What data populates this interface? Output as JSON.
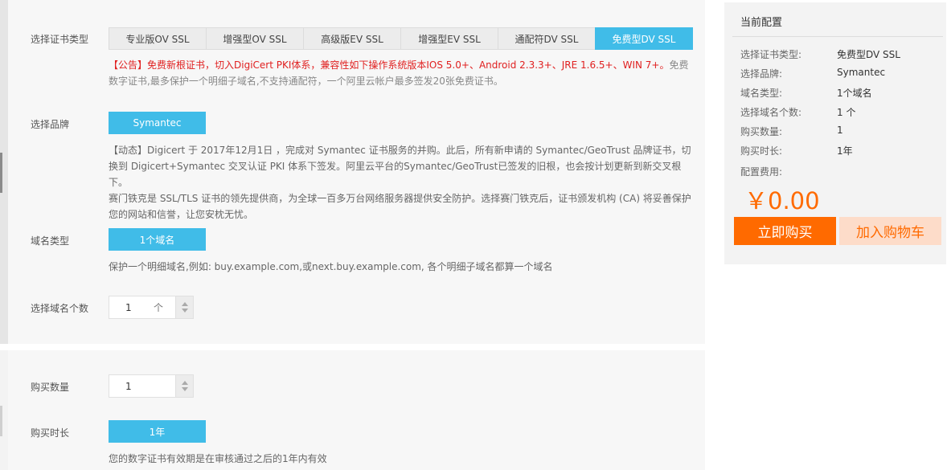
{
  "cert_type": {
    "label": "选择证书类型",
    "tabs": [
      "专业版OV SSL",
      "增强型OV SSL",
      "高级版EV SSL",
      "增强型EV SSL",
      "通配符DV SSL",
      "免费型DV SSL"
    ],
    "active_index": 5,
    "notice_red": "【公告】免费新根证书，切入DigiCert PKI体系，兼容性如下操作系统版本IOS 5.0+、Android 2.3.3+、JRE 1.6.5+、WIN 7+。",
    "notice_gray": "免费数字证书,最多保护一个明细子域名,不支持通配符，一个阿里云帐户最多签发20张免费证书。"
  },
  "brand": {
    "label": "选择品牌",
    "button": "Symantec",
    "desc": "【动态】Digicert 于 2017年12月1日 ，完成对 Symantec 证书服务的并购。此后，所有新申请的 Symantec/GeoTrust 品牌证书，切换到 Digicert+Symantec 交叉认证 PKI 体系下签发。阿里云平台的Symantec/GeoTrust已签发的旧根，也会按计划更新到新交叉根下。\n赛门铁克是 SSL/TLS 证书的领先提供商，为全球一百多万台网络服务器提供安全防护。选择赛门铁克后，证书颁发机构 (CA) 将妥善保护您的网站和信誉，让您安枕无忧。"
  },
  "domain_type": {
    "label": "域名类型",
    "button": "1个域名",
    "desc": "保护一个明细域名,例如: buy.example.com,或next.buy.example.com, 各个明细子域名都算一个域名"
  },
  "domain_count": {
    "label": "选择域名个数",
    "value": "1",
    "unit": "个"
  },
  "quantity": {
    "label": "购买数量",
    "value": "1"
  },
  "duration": {
    "label": "购买时长",
    "button": "1年",
    "desc": "您的数字证书有效期是在审核通过之后的1年内有效"
  },
  "config": {
    "title": "当前配置",
    "rows": [
      {
        "label": "选择证书类型:",
        "value": "免费型DV SSL"
      },
      {
        "label": "选择品牌:",
        "value": "Symantec"
      },
      {
        "label": "域名类型:",
        "value": "1个域名"
      },
      {
        "label": "选择域名个数:",
        "value": "1 个"
      },
      {
        "label": "购买数量:",
        "value": "1"
      },
      {
        "label": "购买时长:",
        "value": "1年"
      }
    ],
    "fee_label": "配置费用:",
    "price": "￥0.00",
    "buy_button": "立即购买",
    "cart_button": "加入购物车"
  },
  "colors": {
    "accent_blue": "#40bce8",
    "accent_orange": "#ff6a00",
    "notice_red": "#e02020"
  }
}
